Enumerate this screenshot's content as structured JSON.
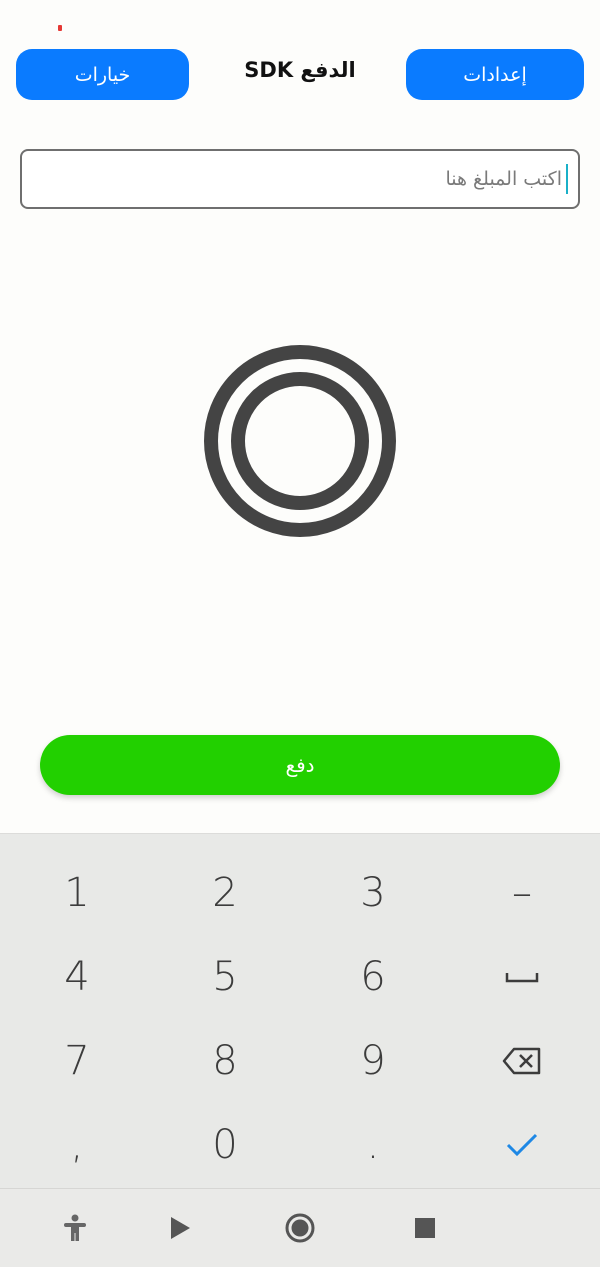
{
  "header": {
    "options_label": "خيارات",
    "title": "الدفع SDK",
    "settings_label": "إعدادات"
  },
  "amount": {
    "placeholder": "اكتب المبلغ هنا",
    "value": ""
  },
  "pay": {
    "label": "دفع"
  },
  "keyboard": {
    "rows": [
      [
        "1",
        "2",
        "3",
        "-"
      ],
      [
        "4",
        "5",
        "6",
        "space-icon"
      ],
      [
        "7",
        "8",
        "9",
        "backspace-icon"
      ],
      [
        ",",
        "0",
        ".",
        "check-icon"
      ]
    ],
    "labels": {
      "k1": "1",
      "k2": "2",
      "k3": "3",
      "minus": "–",
      "k4": "4",
      "k5": "5",
      "k6": "6",
      "k7": "7",
      "k8": "8",
      "k9": "9",
      "comma": ",",
      "k0": "0",
      "period": "."
    }
  },
  "icons": {
    "nfc": "contactless-rings-icon",
    "nav": [
      "accessibility-icon",
      "play-icon",
      "record-icon",
      "stop-icon"
    ]
  },
  "colors": {
    "primary": "#0a7bff",
    "pay": "#22d000",
    "keyboard_bg": "#e8e9e7",
    "check": "#1e88e5",
    "nfc": "#444444"
  }
}
